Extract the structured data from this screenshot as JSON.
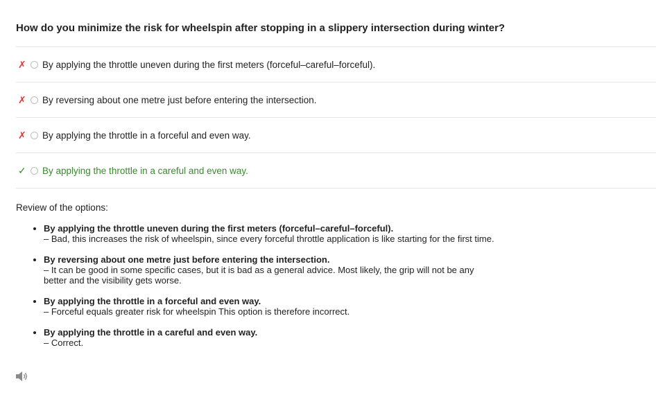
{
  "question": "How do you minimize the risk for wheelspin after stopping in a slippery intersection during winter?",
  "options": [
    {
      "mark": "✗",
      "status": "wrong",
      "text": "By applying the throttle uneven during the first meters (forceful–careful–forceful)."
    },
    {
      "mark": "✗",
      "status": "wrong",
      "text": "By reversing about one metre just before entering the intersection."
    },
    {
      "mark": "✗",
      "status": "wrong",
      "text": "By applying the throttle in a forceful and even way."
    },
    {
      "mark": "✓",
      "status": "correct",
      "text": "By applying the throttle in a careful and even way."
    }
  ],
  "review": {
    "title": "Review of the options:",
    "items": [
      {
        "title": "By applying the throttle uneven during the first meters (forceful–careful–forceful).",
        "desc": "– Bad, this increases the risk of wheelspin, since every forceful throttle application is like starting for the first time."
      },
      {
        "title": "By reversing about one metre just before entering the intersection.",
        "desc": "– It can be good in some specific cases, but it is bad as a general advice. Most likely, the grip will not be any better and the visibility gets worse."
      },
      {
        "title": "By applying the throttle in a forceful and even way.",
        "desc": "– Forceful equals greater risk for wheelspin This option is therefore incorrect."
      },
      {
        "title": "By applying the throttle in a careful and even way.",
        "desc": "– Correct."
      }
    ]
  },
  "colors": {
    "wrong": "#d93a3a",
    "correct": "#3a8a2e",
    "divider": "#e3e3e3"
  },
  "icons": {
    "audio": "speaker-icon"
  }
}
